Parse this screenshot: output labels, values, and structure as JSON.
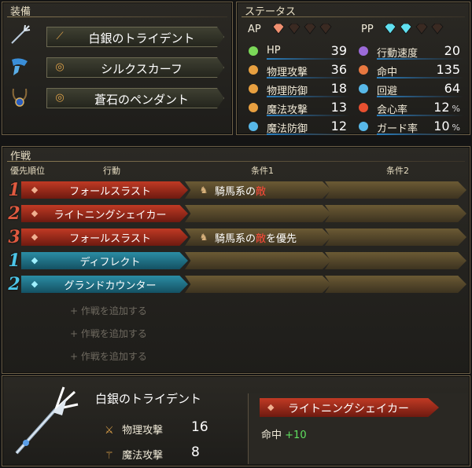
{
  "equipment": {
    "title": "装備",
    "items": [
      {
        "icon": "trident-icon",
        "name": "白銀のトライデント"
      },
      {
        "icon": "scarf-icon",
        "name": "シルクスカーフ"
      },
      {
        "icon": "pendant-icon",
        "name": "蒼石のペンダント"
      }
    ]
  },
  "status": {
    "title": "ステータス",
    "ap_label": "AP",
    "pp_label": "PP",
    "ap_filled": 1,
    "ap_total": 4,
    "pp_filled": 2,
    "pp_total": 4,
    "left": [
      {
        "label": "HP",
        "value": "39",
        "icon": "heart-icon",
        "color": "#7bd858"
      },
      {
        "label": "物理攻撃",
        "value": "36",
        "icon": "sword-icon",
        "color": "#e8a040"
      },
      {
        "label": "物理防御",
        "value": "18",
        "icon": "shield-icon",
        "color": "#e8a040"
      },
      {
        "label": "魔法攻撃",
        "value": "13",
        "icon": "staff-icon",
        "color": "#e8a040"
      },
      {
        "label": "魔法防御",
        "value": "12",
        "icon": "magic-defense-icon",
        "color": "#58b8e8"
      }
    ],
    "right": [
      {
        "label": "行動速度",
        "value": "20",
        "unit": "",
        "icon": "speed-icon",
        "color": "#9b6ad8"
      },
      {
        "label": "命中",
        "value": "135",
        "unit": "",
        "icon": "target-icon",
        "color": "#e87840"
      },
      {
        "label": "回避",
        "value": "64",
        "unit": "",
        "icon": "evade-icon",
        "color": "#58b8e8"
      },
      {
        "label": "会心率",
        "value": "12",
        "unit": "%",
        "icon": "critical-icon",
        "color": "#e85030"
      },
      {
        "label": "ガード率",
        "value": "10",
        "unit": "%",
        "icon": "guard-icon",
        "color": "#58b8e8"
      }
    ]
  },
  "tactics": {
    "title": "作戦",
    "headers": {
      "priority": "優先順位",
      "action": "行動",
      "cond1": "条件1",
      "cond2": "条件2"
    },
    "rows": [
      {
        "priority": "1",
        "type": "red",
        "action": "フォールスラスト",
        "cond1_pre": "騎馬系の",
        "cond1_enemy": "敵",
        "cond1_post": ""
      },
      {
        "priority": "2",
        "type": "red",
        "action": "ライトニングシェイカー",
        "cond1_pre": "",
        "cond1_enemy": "",
        "cond1_post": ""
      },
      {
        "priority": "3",
        "type": "red",
        "action": "フォールスラスト",
        "cond1_pre": "騎馬系の",
        "cond1_enemy": "敵",
        "cond1_post": "を優先"
      },
      {
        "priority": "1",
        "type": "blue",
        "action": "ディフレクト",
        "cond1_pre": "",
        "cond1_enemy": "",
        "cond1_post": ""
      },
      {
        "priority": "2",
        "type": "blue",
        "action": "グランドカウンター",
        "cond1_pre": "",
        "cond1_enemy": "",
        "cond1_post": ""
      }
    ],
    "add_label": "+ 作戦を追加する"
  },
  "detail": {
    "weapon_name": "白銀のトライデント",
    "stats": [
      {
        "label": "物理攻撃",
        "value": "16",
        "icon": "sword-icon"
      },
      {
        "label": "魔法攻撃",
        "value": "8",
        "icon": "staff-icon"
      }
    ],
    "skill_name": "ライトニングシェイカー",
    "effect_label": "命中",
    "effect_value": "+10"
  }
}
